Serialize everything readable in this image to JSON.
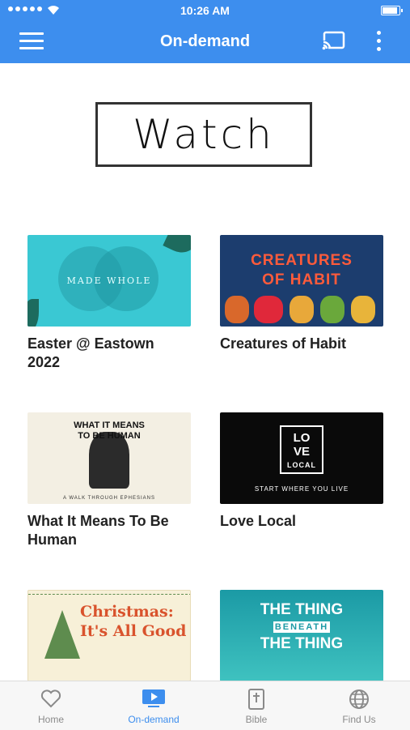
{
  "status_bar": {
    "time": "10:26 AM"
  },
  "header": {
    "title": "On-demand",
    "menu_icon": "hamburger-icon",
    "cast_icon": "cast-icon",
    "more_icon": "more-vertical-icon",
    "accent_color": "#3d8eee"
  },
  "banner": {
    "text": "Watch"
  },
  "cards": [
    {
      "title": "Easter @ Eastown 2022",
      "thumb_text": "MADE WHOLE"
    },
    {
      "title": "Creatures of Habit",
      "thumb_line1": "CREATURES",
      "thumb_line2": "OF HABIT"
    },
    {
      "title": "What It Means To Be Human",
      "thumb_line1": "WHAT IT MEANS",
      "thumb_line2": "TO BE HUMAN",
      "thumb_sub": "A WALK THROUGH EPHESIANS"
    },
    {
      "title": "Love Local",
      "thumb_line1": "LO",
      "thumb_line2": "VE",
      "thumb_line3": "LOCAL",
      "thumb_sub": "START WHERE YOU LIVE"
    },
    {
      "title": "",
      "thumb_line1": "Christmas:",
      "thumb_line2": "It's All Good"
    },
    {
      "title": "",
      "thumb_line1": "THE THING",
      "thumb_line2": "BENEATH",
      "thumb_line3": "THE THING"
    }
  ],
  "tabs": [
    {
      "label": "Home",
      "icon": "heart-icon"
    },
    {
      "label": "On-demand",
      "icon": "tv-play-icon"
    },
    {
      "label": "Bible",
      "icon": "bible-icon"
    },
    {
      "label": "Find Us",
      "icon": "globe-icon"
    }
  ]
}
